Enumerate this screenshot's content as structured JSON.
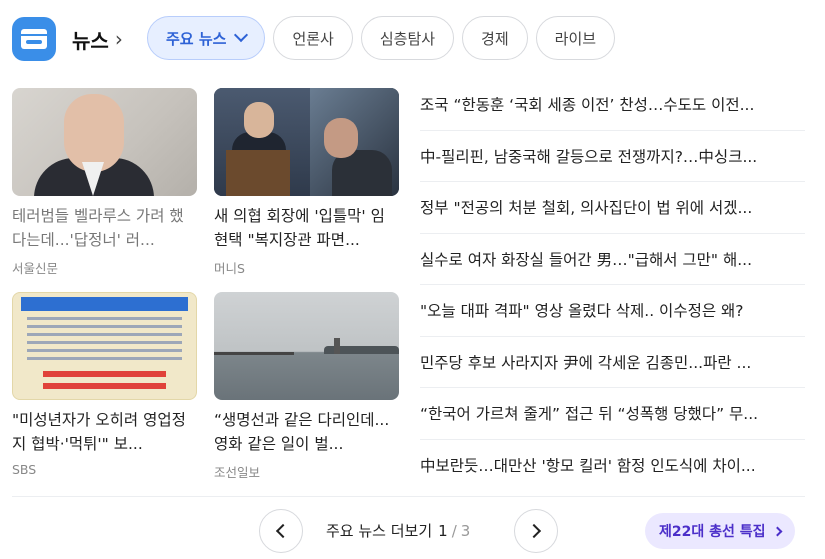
{
  "header": {
    "service_title": "뉴스",
    "icon": "news-card-icon",
    "chevron": "chevron-right-icon"
  },
  "tabs": [
    {
      "label": "주요 뉴스",
      "active": true
    },
    {
      "label": "언론사",
      "active": false
    },
    {
      "label": "심층탐사",
      "active": false
    },
    {
      "label": "경제",
      "active": false
    },
    {
      "label": "라이브",
      "active": false
    }
  ],
  "cards": [
    {
      "title": "테러범들 벨라루스 가려 했다는데...'답정너' 러...",
      "source": "서울신문",
      "dim": true
    },
    {
      "title": "새 의협 회장에 '입틀막' 임현택 \"복지장관 파면...",
      "source": "머니S",
      "dim": false
    },
    {
      "title": "\"미성년자가 오히려 영업정지 협박·'먹튀'\" 보...",
      "source": "SBS",
      "dim": false
    },
    {
      "title": "“생명선과 같은 다리인데... 영화 같은 일이 벌...",
      "source": "조선일보",
      "dim": false
    }
  ],
  "headlines": [
    "조국 “한동훈 ‘국회 세종 이전’ 찬성…수도도 이전...",
    "中-필리핀, 남중국해 갈등으로 전쟁까지?…中싱크...",
    "정부 \"전공의 처분 철회, 의사집단이 법 위에 서겠...",
    "실수로 여자 화장실 들어간 男…\"급해서 그만\" 해...",
    "\"오늘 대파 격파\" 영상 올렸다 삭제.. 이수정은 왜?",
    "민주당 후보 사라지자 尹에 각세운 김종민...파란 ...",
    "“한국어 가르쳐 줄게” 접근 뒤 “성폭행 당했다” 무...",
    "中보란듯…대만산 '항모 킬러' 함정 인도식에 차이..."
  ],
  "pager": {
    "label": "주요 뉴스 더보기",
    "current": "1",
    "separator": "/",
    "total": "3"
  },
  "special": {
    "label": "제22대 총선 특집"
  },
  "colors": {
    "active_tab_bg": "#e7efff",
    "active_tab_text": "#2e62d6",
    "special_bg": "#ebe8ff",
    "special_text": "#4b2fc9",
    "app_icon": "#3a8ee8"
  }
}
